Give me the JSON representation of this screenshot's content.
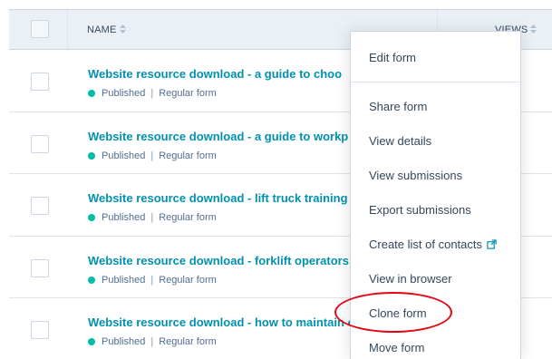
{
  "header": {
    "name_label": "NAME",
    "views_label": "VIEWS"
  },
  "rows": [
    {
      "title": "Website resource download - a guide to choo",
      "status": "Published",
      "type": "Regular form"
    },
    {
      "title": "Website resource download - a guide to workp",
      "status": "Published",
      "type": "Regular form"
    },
    {
      "title": "Website resource download - lift truck training",
      "status": "Published",
      "type": "Regular form"
    },
    {
      "title": "Website resource download - forklift operators",
      "status": "Published",
      "type": "Regular form"
    },
    {
      "title": "Website resource download - how to maintain c",
      "status": "Published",
      "type": "Regular form"
    }
  ],
  "menu": {
    "items": [
      "Edit form",
      "Share form",
      "View details",
      "View submissions",
      "Export submissions",
      "Create list of contacts",
      "View in browser",
      "Clone form",
      "Move form"
    ]
  },
  "colors": {
    "link": "#0091ae",
    "published": "#00bda5",
    "highlight": "#e30613"
  }
}
